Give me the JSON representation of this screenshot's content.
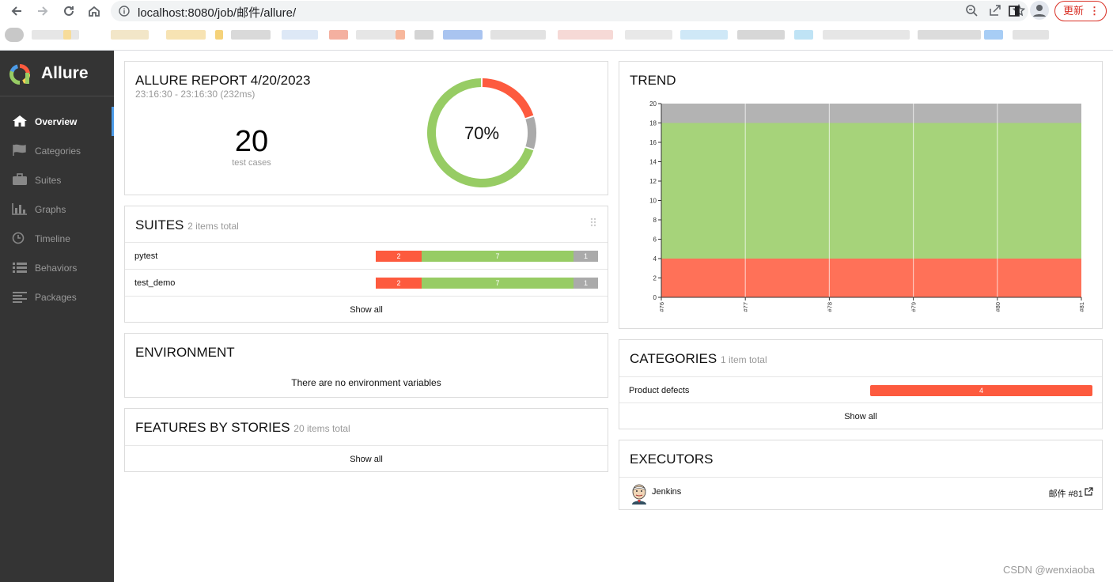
{
  "browser": {
    "url": "localhost:8080/job/邮件/allure/",
    "update_label": "更新",
    "menu_label": "⋮"
  },
  "sidebar": {
    "brand": "Allure",
    "items": [
      {
        "label": "Overview",
        "icon": "home-icon"
      },
      {
        "label": "Categories",
        "icon": "flag-icon"
      },
      {
        "label": "Suites",
        "icon": "briefcase-icon"
      },
      {
        "label": "Graphs",
        "icon": "bar-chart-icon"
      },
      {
        "label": "Timeline",
        "icon": "clock-icon"
      },
      {
        "label": "Behaviors",
        "icon": "list-icon"
      },
      {
        "label": "Packages",
        "icon": "align-left-icon"
      }
    ]
  },
  "summary": {
    "title": "ALLURE REPORT 4/20/2023",
    "time": "23:16:30 - 23:16:30 (232ms)",
    "count": "20",
    "count_label": "test cases",
    "percent": "70%",
    "donut": {
      "failed": 2,
      "broken": 0,
      "passed": 7,
      "skipped": 1
    }
  },
  "suites": {
    "title": "SUITES",
    "subtitle": "2 items total",
    "rows": [
      {
        "name": "pytest",
        "failed": "2",
        "passed": "7",
        "skipped": "1"
      },
      {
        "name": "test_demo",
        "failed": "2",
        "passed": "7",
        "skipped": "1"
      }
    ],
    "show_all": "Show all"
  },
  "environment": {
    "title": "ENVIRONMENT",
    "empty": "There are no environment variables"
  },
  "features": {
    "title": "FEATURES BY STORIES",
    "subtitle": "20 items total",
    "show_all": "Show all"
  },
  "trend": {
    "title": "TREND"
  },
  "categories": {
    "title": "CATEGORIES",
    "subtitle": "1 item total",
    "rows": [
      {
        "name": "Product defects",
        "count": "4"
      }
    ],
    "show_all": "Show all"
  },
  "executors": {
    "title": "EXECUTORS",
    "name": "Jenkins",
    "build": "邮件 #81"
  },
  "watermark": "CSDN @wenxiaoba",
  "colors": {
    "failed": "#fd5a3e",
    "passed": "#97cc64",
    "skipped": "#aaaaaa",
    "trend_failed": "#ff7158",
    "trend_passed": "#a6d37a",
    "trend_skipped": "#b3b3b3"
  },
  "chart_data": {
    "type": "area",
    "x": [
      "#76",
      "#77",
      "#78",
      "#79",
      "#80",
      "#81"
    ],
    "ylim": [
      0,
      20
    ],
    "yticks": [
      "0",
      "2",
      "4",
      "6",
      "8",
      "10",
      "12",
      "14",
      "16",
      "18",
      "20"
    ],
    "stacked": true,
    "series": [
      {
        "name": "failed",
        "values": [
          4,
          4,
          4,
          4,
          4,
          4
        ]
      },
      {
        "name": "passed",
        "values": [
          14,
          14,
          14,
          14,
          14,
          14
        ]
      },
      {
        "name": "skipped",
        "values": [
          2,
          2,
          2,
          2,
          2,
          2
        ]
      }
    ],
    "grid": true
  }
}
